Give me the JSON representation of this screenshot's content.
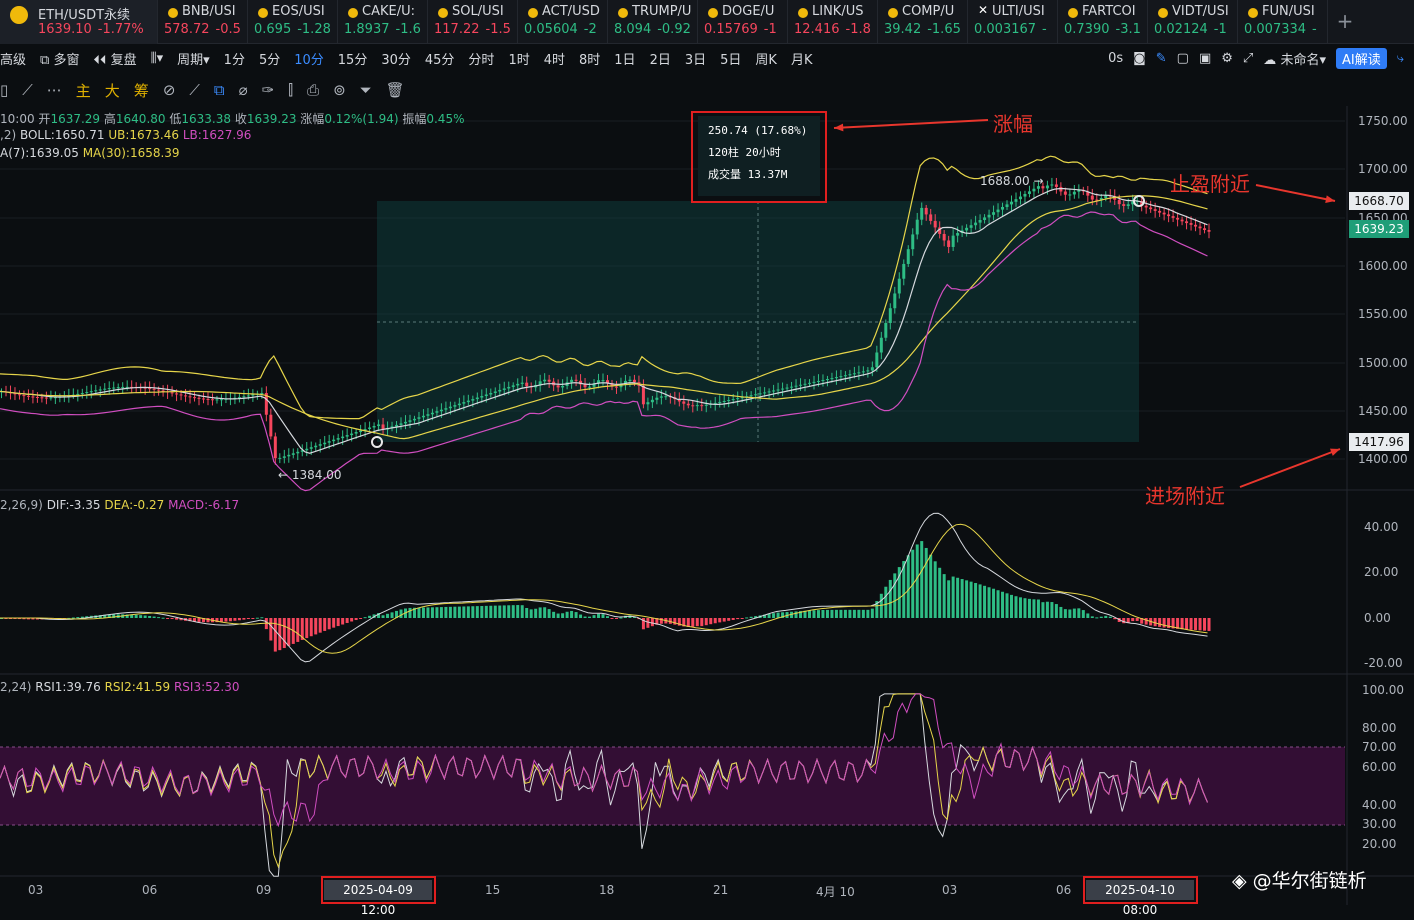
{
  "tabs": [
    {
      "name": "ETH/USDT永续",
      "price": "1639.10",
      "change": "-1.77%",
      "dir": "dn",
      "active": true
    },
    {
      "name": "BNB/USI",
      "price": "578.72",
      "change": "-0.5",
      "dir": "dn"
    },
    {
      "name": "EOS/USI",
      "price": "0.695",
      "change": "-1.28",
      "dir": "up"
    },
    {
      "name": "CAKE/U:",
      "price": "1.8937",
      "change": "-1.6",
      "dir": "up"
    },
    {
      "name": "SOL/USI",
      "price": "117.22",
      "change": "-1.5",
      "dir": "dn"
    },
    {
      "name": "ACT/USD",
      "price": "0.05604",
      "change": "-2",
      "dir": "up"
    },
    {
      "name": "TRUMP/U",
      "price": "8.094",
      "change": "-0.92",
      "dir": "up"
    },
    {
      "name": "DOGE/U",
      "price": "0.15769",
      "change": "-1",
      "dir": "dn"
    },
    {
      "name": "LINK/US",
      "price": "12.416",
      "change": "-1.8",
      "dir": "dn"
    },
    {
      "name": "COMP/U",
      "price": "39.42",
      "change": "-1.65",
      "dir": "up"
    },
    {
      "name": "ULTI/USI",
      "price": "0.003167",
      "change": "-",
      "dir": "up",
      "x": true
    },
    {
      "name": "FARTCOI",
      "price": "0.7390",
      "change": "-3.1",
      "dir": "up"
    },
    {
      "name": "VIDT/USI",
      "price": "0.02124",
      "change": "-1",
      "dir": "up"
    },
    {
      "name": "FUN/USI",
      "price": "0.007334",
      "change": "-",
      "dir": "up"
    }
  ],
  "add_tab": "+",
  "toolbar1": {
    "items": [
      "高级",
      "多窗",
      "复盘",
      "周期",
      "1分",
      "5分",
      "10分",
      "15分",
      "30分",
      "45分",
      "分时",
      "1时",
      "4时",
      "8时",
      "1日",
      "2日",
      "3日",
      "5日",
      "周K",
      "月K"
    ],
    "active": "10分",
    "right": [
      "0s",
      "未命名",
      "AI解读"
    ]
  },
  "toolbar2": {
    "main": "主",
    "big": "大",
    "chip": "筹"
  },
  "ohlc": {
    "time": "10:00",
    "open_label": "开",
    "open": "1637.29",
    "high_label": "高",
    "high": "1640.80",
    "low_label": "低",
    "low": "1633.38",
    "close_label": "收",
    "close": "1639.23",
    "chg_label": "涨幅",
    "chg": "0.12%(1.94)",
    "amp_label": "振幅",
    "amp": "0.45%"
  },
  "boll": {
    "label": "BOLL:1650.71",
    "ub": "UB:1673.46",
    "lb": "LB:1627.96",
    "prefix": ",2)"
  },
  "ma": {
    "ma7": "A(7):1639.05",
    "ma30": "MA(30):1658.39"
  },
  "macd": {
    "prefix": "2,26,9)",
    "dif": "DIF:-3.35",
    "dea": "DEA:-0.27",
    "macd": "MACD:-6.17"
  },
  "rsi": {
    "prefix": "2,24)",
    "r1": "RSI1:39.76",
    "r2": "RSI2:41.59",
    "r3": "RSI3:52.30"
  },
  "price_axis": [
    "1750.00",
    "1700.00",
    "1650.00",
    "1600.00",
    "1550.00",
    "1500.00",
    "1450.00",
    "1400.00"
  ],
  "macd_axis": [
    "40.00",
    "20.00",
    "0.00",
    "-20.00"
  ],
  "rsi_axis": [
    "100.00",
    "80.00",
    "70.00",
    "60.00",
    "40.00",
    "30.00",
    "20.00"
  ],
  "x_axis": [
    "03",
    "06",
    "09",
    "15",
    "18",
    "21",
    "4月 10",
    "03",
    "06"
  ],
  "date_tags": [
    "2025-04-09 12:00",
    "2025-04-10 08:00"
  ],
  "tooltip": {
    "l1": "250.74 (17.68%)",
    "l2": "120柱 20小时",
    "l3": "成交量 13.37M"
  },
  "annotations": {
    "rise": "涨幅",
    "tp": "止盈附近",
    "entry": "进场附近"
  },
  "price_tags": {
    "tp": "1668.70",
    "current": "1639.23",
    "entry": "1417.96"
  },
  "markers": {
    "low": "← 1384.00",
    "high": "1688.00 →"
  },
  "watermark": "@华尔街链析",
  "colors": {
    "up": "#2ebd85",
    "down": "#f6465d",
    "boll": "#e6d54a",
    "accent": "#3b8cff",
    "annot": "#e8362d"
  }
}
